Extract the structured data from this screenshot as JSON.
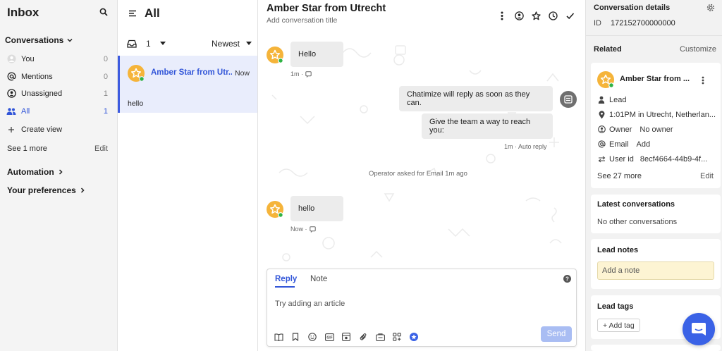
{
  "nav": {
    "title": "Inbox",
    "conversations_label": "Conversations",
    "items": [
      {
        "label": "You",
        "count": "0",
        "icon": "avatar-icon"
      },
      {
        "label": "Mentions",
        "count": "0",
        "icon": "at-icon"
      },
      {
        "label": "Unassigned",
        "count": "1",
        "icon": "unassigned-icon"
      },
      {
        "label": "All",
        "count": "1",
        "icon": "team-icon"
      }
    ],
    "create_view": "Create view",
    "see_more": "See 1 more",
    "edit": "Edit",
    "automation": "Automation",
    "preferences": "Your preferences"
  },
  "list": {
    "title": "All",
    "open_count": "1",
    "sort": "Newest",
    "conversation": {
      "name": "Amber Star from Utr...",
      "time": "Now",
      "preview": "hello"
    }
  },
  "main": {
    "title": "Amber Star from Utrecht",
    "subtitle": "Add conversation title",
    "messages": [
      {
        "text": "Hello",
        "meta": "1m ·"
      },
      {
        "text": "Chatimize will reply as soon as they can."
      },
      {
        "text": "Give the team a way to reach you:",
        "meta": "1m · Auto reply"
      },
      {
        "text": "hello",
        "meta": "Now ·"
      }
    ],
    "event": "Operator asked for Email 1m ago",
    "composer": {
      "tab_reply": "Reply",
      "tab_note": "Note",
      "placeholder": "Try adding an article",
      "send": "Send"
    }
  },
  "side": {
    "details_title": "Conversation details",
    "id_label": "ID",
    "id_value": "172152700000000",
    "related": "Related",
    "customize": "Customize",
    "contact": {
      "name": "Amber Star from ...",
      "role": "Lead",
      "location": "1:01PM in Utrecht, Netherlan...",
      "owner_label": "Owner",
      "owner_value": "No owner",
      "email_label": "Email",
      "email_value": "Add",
      "userid_label": "User id",
      "userid_value": "8ecf4664-44b9-4f...",
      "see_more": "See 27 more",
      "edit": "Edit"
    },
    "latest_title": "Latest conversations",
    "latest_value": "No other conversations",
    "notes_title": "Lead notes",
    "notes_placeholder": "Add a note",
    "tags_title": "Lead tags",
    "add_tag": "+ Add tag"
  },
  "colors": {
    "accent": "#3155d8",
    "star_avatar": "#f5b43a",
    "online": "#2fb344",
    "messenger": "#3a62e6"
  }
}
